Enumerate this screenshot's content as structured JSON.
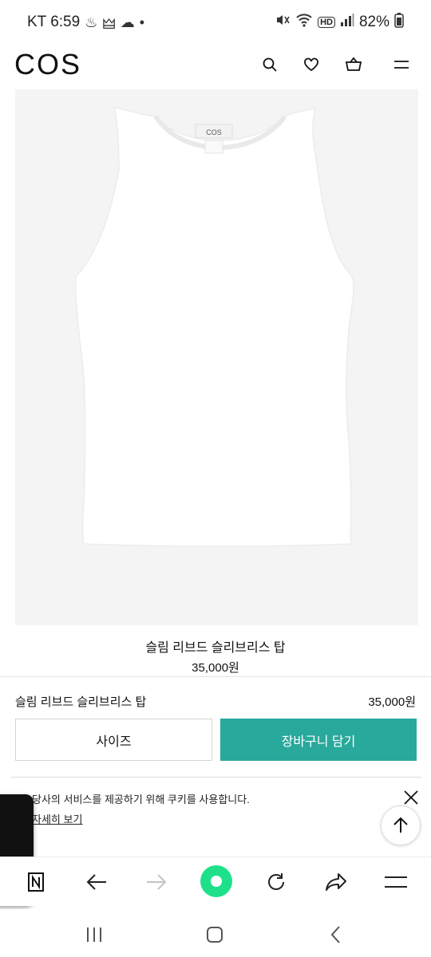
{
  "status_bar": {
    "carrier_time": "KT 6:59",
    "notification_icons": [
      "♨",
      "🜲",
      "☁",
      "•"
    ],
    "hd_badge": "HD",
    "battery": "82%"
  },
  "header": {
    "logo": "COS",
    "icons": [
      "search-icon",
      "heart-icon",
      "basket-icon",
      "menu-icon"
    ]
  },
  "product": {
    "title": "슬림 리브드 슬리브리스 탑",
    "price": "35,000원",
    "image_label": "COS"
  },
  "sticky_bar": {
    "name": "슬림 리브드 슬리브리스 탑",
    "price": "35,000원",
    "size_label": "사이즈",
    "add_to_cart_label": "장바구니 담기",
    "accent_color": "#29a99c"
  },
  "cookie_banner": {
    "text": "당사의 서비스를 제공하기 위해 쿠키를 사용합니다.",
    "link": "자세히 보기"
  },
  "browser_toolbar": {
    "home_color": "#1ee08a"
  }
}
